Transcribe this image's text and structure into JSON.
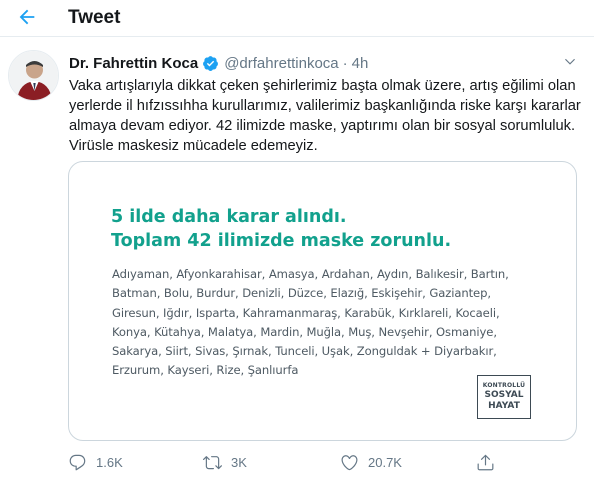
{
  "header": {
    "title": "Tweet"
  },
  "tweet": {
    "display_name": "Dr. Fahrettin Koca",
    "handle": "@drfahrettinkoca",
    "separator": "·",
    "time": "4h",
    "text": "Vaka artışlarıyla dikkat çeken şehirlerimiz başta olmak üzere, artış eğilimi olan yerlerde il hıfzıssıhha kurullarımız, valilerimiz başkanlığında riske karşı kararlar almaya devam ediyor. 42 ilimizde maske, yaptırımı olan bir sosyal sorumluluk. Virüsle maskesiz mücadele edemeyiz."
  },
  "media": {
    "headline_line1": "5 ilde daha karar alındı.",
    "headline_line2": "Toplam 42 ilimizde maske zorunlu.",
    "cities": "Adıyaman, Afyonkarahisar, Amasya, Ardahan, Aydın, Balıkesir, Bartın, Batman, Bolu, Burdur, Denizli, Düzce, Elazığ, Eskişehir, Gaziantep, Giresun, Iğdır, Isparta, Kahramanmaraş, Karabük, Kırklareli, Kocaeli, Konya, Kütahya, Malatya, Mardin, Muğla, Muş, Nevşehir, Osmaniye, Sakarya, Siirt, Sivas, Şırnak, Tunceli, Uşak, Zonguldak + Diyarbakır, Erzurum, Kayseri, Rize, Şanlıurfa",
    "logo_line1": "KONTROLLÜ",
    "logo_line2": "SOSYAL",
    "logo_line3": "HAYAT"
  },
  "actions": {
    "reply_count": "1.6K",
    "retweet_count": "3K",
    "like_count": "20.7K"
  },
  "icons": {
    "back": "arrow-left-icon",
    "verified": "verified-badge-icon",
    "caret": "chevron-down-icon",
    "reply": "reply-icon",
    "retweet": "retweet-icon",
    "like": "heart-icon",
    "share": "share-icon"
  },
  "colors": {
    "accent": "#1da1f2",
    "headline": "#12a18d",
    "secondary_text": "#657786"
  }
}
